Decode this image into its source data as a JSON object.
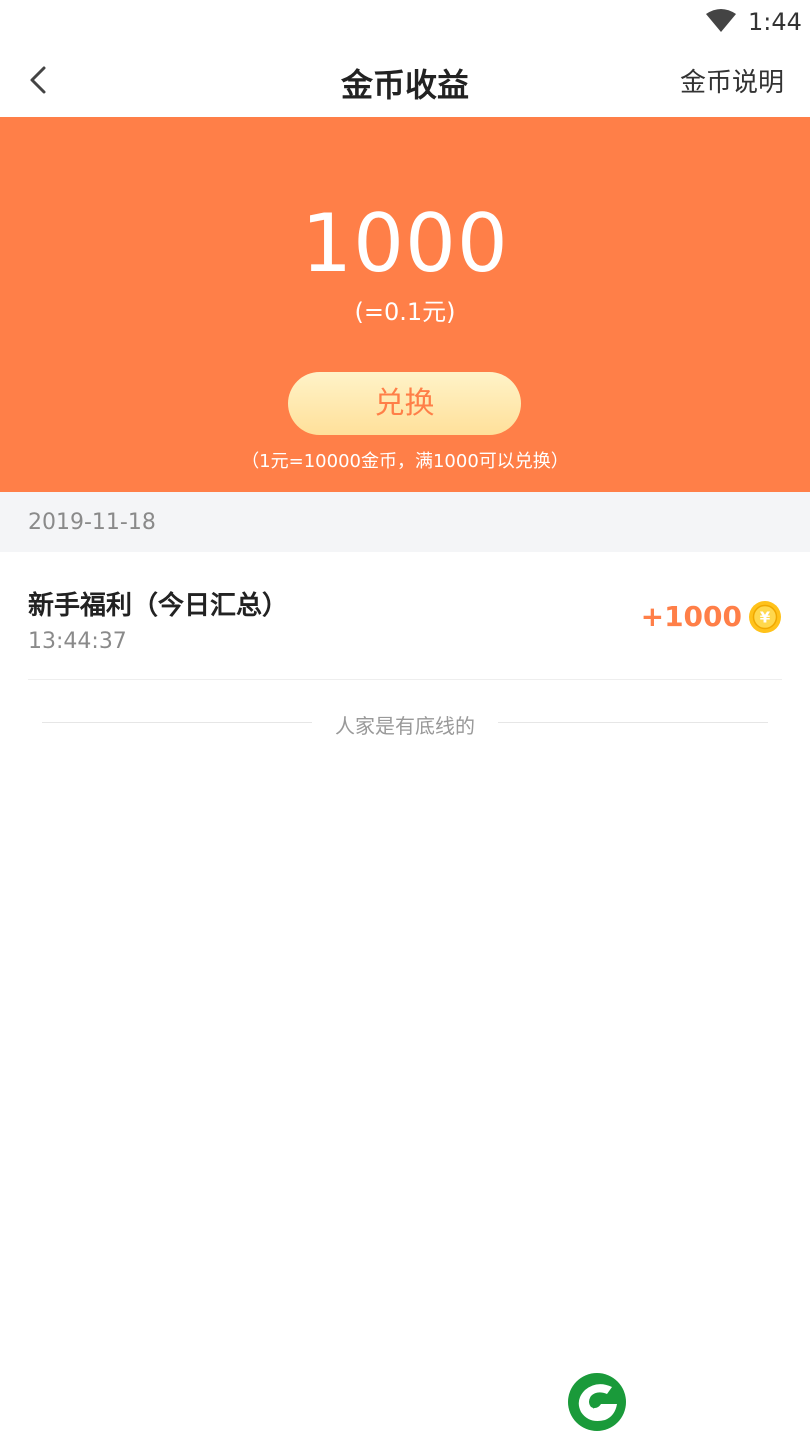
{
  "status_bar": {
    "time": "1:44"
  },
  "nav": {
    "title": "金币收益",
    "help": "金币说明"
  },
  "hero": {
    "amount": "1000",
    "equivalent": "(=0.1元)",
    "exchange_label": "兑换",
    "rule": "（1元=10000金币，满1000可以兑换）"
  },
  "records": {
    "date": "2019-11-18",
    "items": [
      {
        "name": "新手福利（今日汇总）",
        "time": "13:44:37",
        "value": "+1000"
      }
    ],
    "end_text": "人家是有底线的"
  },
  "colors": {
    "accent": "#ff7f48",
    "coin": "#ffc21a",
    "logo": "#1a9a3a"
  }
}
